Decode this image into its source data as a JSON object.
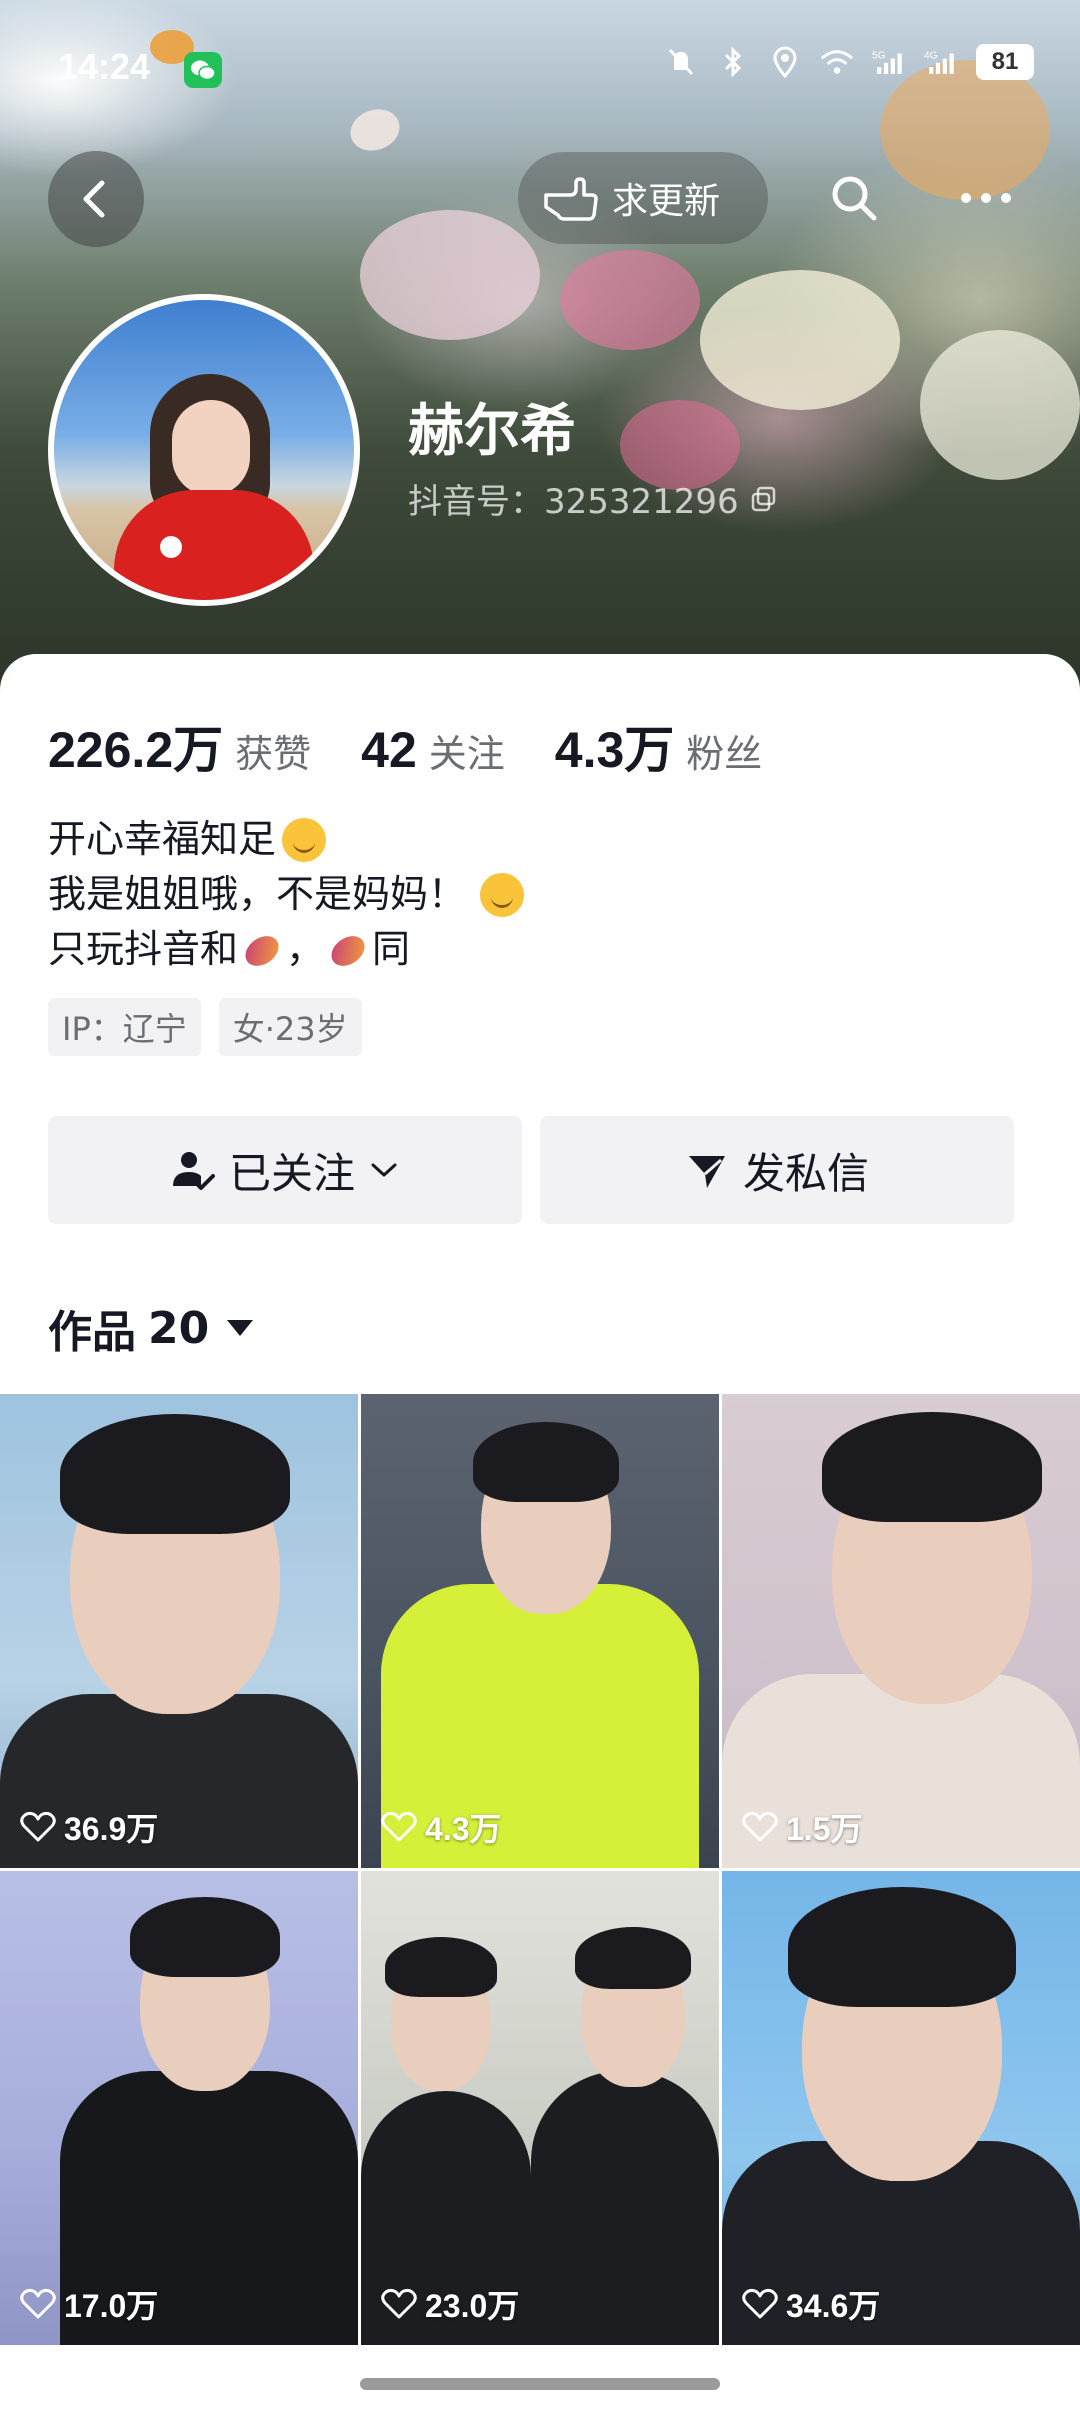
{
  "status_bar": {
    "time": "14:24",
    "battery": "81",
    "icons": [
      "wechat-icon",
      "mute-bell-icon",
      "bluetooth-icon",
      "location-icon",
      "wifi-icon",
      "signal-5g-icon",
      "signal-4g-icon"
    ]
  },
  "header": {
    "update_label": "求更新",
    "icons": [
      "back-arrow-icon",
      "hand-point-icon",
      "search-icon",
      "more-icon"
    ]
  },
  "profile": {
    "nickname": "赫尔希",
    "douyin_id": "抖音号：325321296"
  },
  "stats": [
    {
      "value": "226.2万",
      "label": "获赞"
    },
    {
      "value": "42",
      "label": "关注"
    },
    {
      "value": "4.3万",
      "label": "粉丝"
    }
  ],
  "bio": {
    "line1": "开心幸福知足",
    "line2": "我是姐姐哦，不是妈妈！",
    "line3_a": "只玩抖音和",
    "line3_b": "，",
    "line3_c": "同"
  },
  "tags": [
    "IP：辽宁",
    "女·23岁"
  ],
  "actions": {
    "follow_label": "已关注",
    "message_label": "发私信"
  },
  "works": {
    "label": "作品",
    "count": "20"
  },
  "videos": [
    {
      "likes": "36.9万"
    },
    {
      "likes": "4.3万"
    },
    {
      "likes": "1.5万"
    },
    {
      "likes": "17.0万"
    },
    {
      "likes": "23.0万"
    },
    {
      "likes": "34.6万"
    }
  ],
  "colors": {
    "text_primary": "#161823",
    "text_secondary": "#6b6d73",
    "button_bg": "#f2f2f4",
    "wechat_green": "#21c05a"
  }
}
